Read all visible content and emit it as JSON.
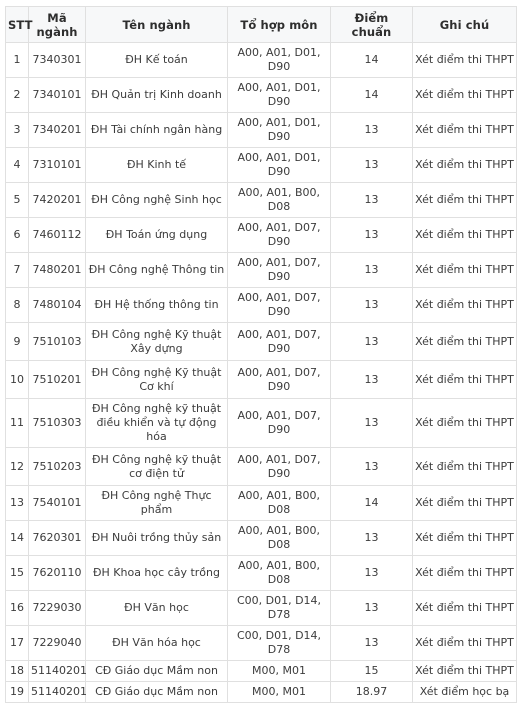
{
  "table": {
    "headers": [
      "STT",
      "Mã ngành",
      "Tên ngành",
      "Tổ hợp môn",
      "Điểm chuẩn",
      "Ghi chú"
    ],
    "header_colors": {
      "background": "#f7f8f9",
      "border": "#e0e0e0",
      "text": "#2e2e2e"
    },
    "rows": [
      {
        "stt": "1",
        "ma_nganh": "7340301",
        "ten_nganh": "ĐH Kế toán",
        "to_hop_mon": "A00, A01, D01, D90",
        "diem_chuan": "14",
        "ghi_chu": "Xét điểm thi THPT"
      },
      {
        "stt": "2",
        "ma_nganh": "7340101",
        "ten_nganh": "ĐH Quản trị Kinh doanh",
        "to_hop_mon": "A00, A01, D01, D90",
        "diem_chuan": "14",
        "ghi_chu": "Xét điểm thi THPT"
      },
      {
        "stt": "3",
        "ma_nganh": "7340201",
        "ten_nganh": "ĐH Tài chính ngân hàng",
        "to_hop_mon": "A00, A01, D01, D90",
        "diem_chuan": "13",
        "ghi_chu": "Xét điểm thi THPT"
      },
      {
        "stt": "4",
        "ma_nganh": "7310101",
        "ten_nganh": "ĐH Kinh tế",
        "to_hop_mon": "A00, A01, D01, D90",
        "diem_chuan": "13",
        "ghi_chu": "Xét điểm thi THPT"
      },
      {
        "stt": "5",
        "ma_nganh": "7420201",
        "ten_nganh": "ĐH Công nghệ Sinh học",
        "to_hop_mon": "A00, A01, B00, D08",
        "diem_chuan": "13",
        "ghi_chu": "Xét điểm thi THPT"
      },
      {
        "stt": "6",
        "ma_nganh": "7460112",
        "ten_nganh": "ĐH Toán ứng dụng",
        "to_hop_mon": "A00, A01, D07, D90",
        "diem_chuan": "13",
        "ghi_chu": "Xét điểm thi THPT"
      },
      {
        "stt": "7",
        "ma_nganh": "7480201",
        "ten_nganh": "ĐH Công nghệ Thông tin",
        "to_hop_mon": "A00, A01, D07, D90",
        "diem_chuan": "13",
        "ghi_chu": "Xét điểm thi THPT"
      },
      {
        "stt": "8",
        "ma_nganh": "7480104",
        "ten_nganh": "ĐH Hệ thống thông tin",
        "to_hop_mon": "A00, A01, D07, D90",
        "diem_chuan": "13",
        "ghi_chu": "Xét điểm thi THPT"
      },
      {
        "stt": "9",
        "ma_nganh": "7510103",
        "ten_nganh": "ĐH Công nghệ Kỹ thuật Xây dựng",
        "to_hop_mon": "A00, A01, D07, D90",
        "diem_chuan": "13",
        "ghi_chu": "Xét điểm thi THPT",
        "tall": true
      },
      {
        "stt": "10",
        "ma_nganh": "7510201",
        "ten_nganh": "ĐH Công nghệ Kỹ thuật Cơ khí",
        "to_hop_mon": "A00, A01, D07, D90",
        "diem_chuan": "13",
        "ghi_chu": "Xét điểm thi THPT",
        "tall": true
      },
      {
        "stt": "11",
        "ma_nganh": "7510303",
        "ten_nganh": "ĐH Công nghệ kỹ thuật điều khiển và tự động hóa",
        "to_hop_mon": "A00, A01, D07, D90",
        "diem_chuan": "13",
        "ghi_chu": "Xét điểm thi THPT",
        "tall": true
      },
      {
        "stt": "12",
        "ma_nganh": "7510203",
        "ten_nganh": "ĐH Công nghệ kỹ thuật cơ điện tử",
        "to_hop_mon": "A00, A01, D07, D90",
        "diem_chuan": "13",
        "ghi_chu": "Xét điểm thi THPT",
        "tall": true
      },
      {
        "stt": "13",
        "ma_nganh": "7540101",
        "ten_nganh": "ĐH Công nghệ Thực phẩm",
        "to_hop_mon": "A00, A01, B00, D08",
        "diem_chuan": "14",
        "ghi_chu": "Xét điểm thi THPT"
      },
      {
        "stt": "14",
        "ma_nganh": "7620301",
        "ten_nganh": "ĐH Nuôi trồng thủy sản",
        "to_hop_mon": "A00, A01, B00, D08",
        "diem_chuan": "13",
        "ghi_chu": "Xét điểm thi THPT"
      },
      {
        "stt": "15",
        "ma_nganh": "7620110",
        "ten_nganh": "ĐH Khoa học cây trồng",
        "to_hop_mon": "A00, A01, B00, D08",
        "diem_chuan": "13",
        "ghi_chu": "Xét điểm thi THPT"
      },
      {
        "stt": "16",
        "ma_nganh": "7229030",
        "ten_nganh": "ĐH Văn học",
        "to_hop_mon": "C00, D01, D14, D78",
        "diem_chuan": "13",
        "ghi_chu": "Xét điểm thi THPT"
      },
      {
        "stt": "17",
        "ma_nganh": "7229040",
        "ten_nganh": "ĐH Văn hóa học",
        "to_hop_mon": "C00, D01, D14, D78",
        "diem_chuan": "13",
        "ghi_chu": "Xét điểm thi THPT"
      },
      {
        "stt": "18",
        "ma_nganh": "51140201",
        "ten_nganh": "CĐ Giáo dục Mầm non",
        "to_hop_mon": "M00, M01",
        "diem_chuan": "15",
        "ghi_chu": "Xét điểm thi THPT"
      },
      {
        "stt": "19",
        "ma_nganh": "51140201",
        "ten_nganh": "CĐ Giáo dục Mầm non",
        "to_hop_mon": "M00, M01",
        "diem_chuan": "18.97",
        "ghi_chu": "Xét điểm học bạ"
      }
    ]
  }
}
